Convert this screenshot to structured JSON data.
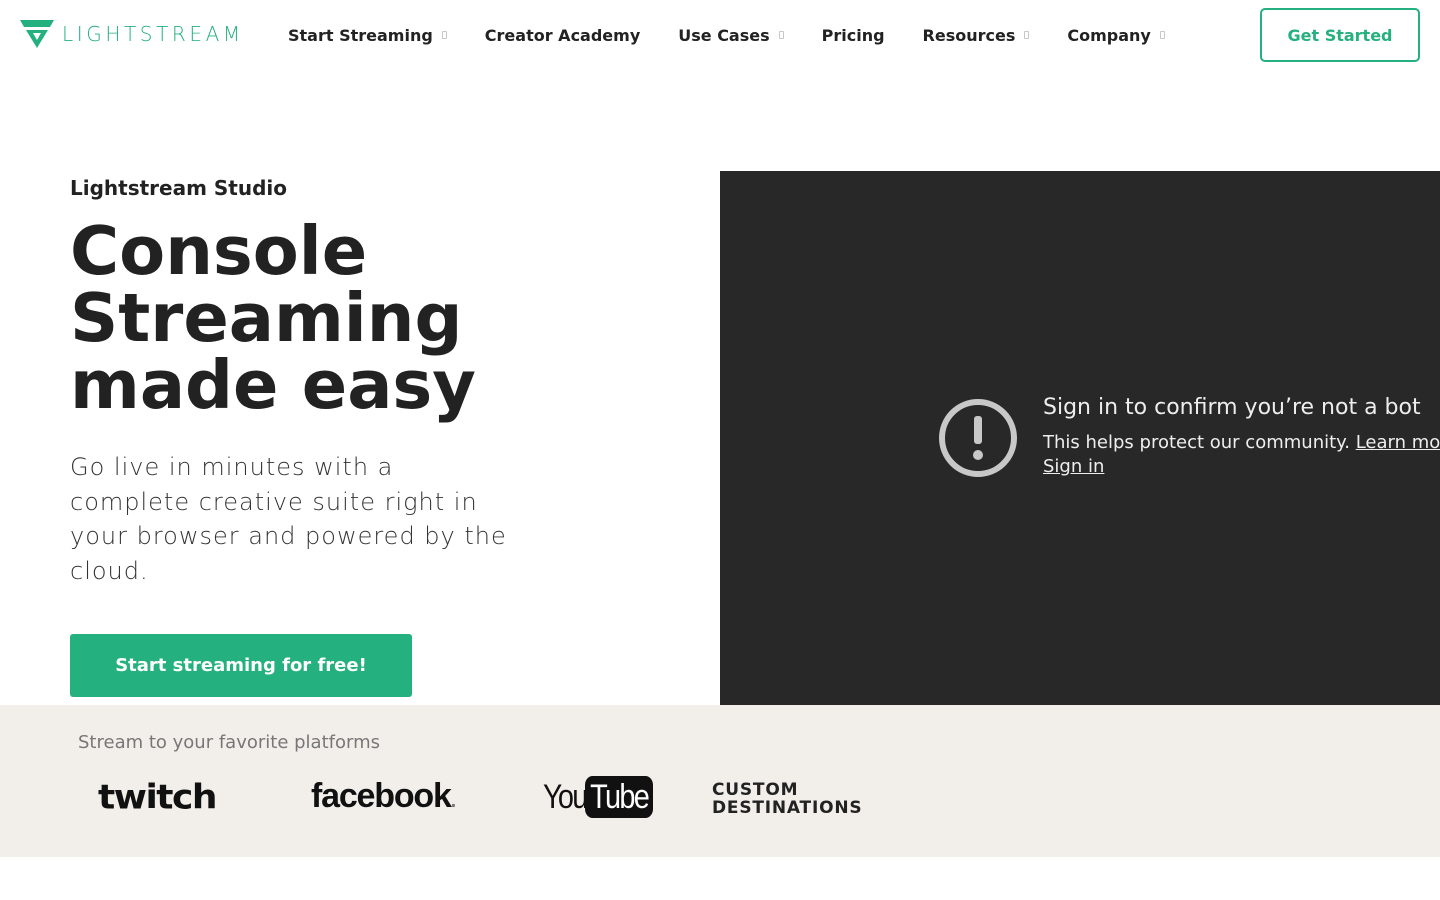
{
  "brand": {
    "name": "LIGHTSTREAM",
    "accent": "#25b07f"
  },
  "nav": {
    "items": [
      {
        "label": "Start Streaming",
        "has_dropdown": true
      },
      {
        "label": "Creator Academy",
        "has_dropdown": false
      },
      {
        "label": "Use Cases",
        "has_dropdown": true
      },
      {
        "label": "Pricing",
        "has_dropdown": false
      },
      {
        "label": "Resources",
        "has_dropdown": true
      },
      {
        "label": "Company",
        "has_dropdown": true
      }
    ],
    "cta_label": "Get Started"
  },
  "hero": {
    "eyebrow": "Lightstream Studio",
    "title_lines": [
      "Console",
      "Streaming",
      "made easy"
    ],
    "subtitle": "Go live in minutes with a complete creative suite right in your browser and powered by the cloud.",
    "cta_label": "Start streaming for free!"
  },
  "video": {
    "icon": "exclamation-circle-icon",
    "title": "Sign in to confirm you’re not a bot",
    "description": "This helps protect our community.",
    "learn_more": "Learn more",
    "sign_in": "Sign in"
  },
  "platforms": {
    "label": "Stream to your favorite platforms",
    "logos": {
      "twitch": "twitch",
      "facebook": "facebook",
      "youtube_you": "You",
      "youtube_tube": "Tube",
      "custom_line1": "CUSTOM",
      "custom_line2": "DESTINATIONS"
    }
  }
}
